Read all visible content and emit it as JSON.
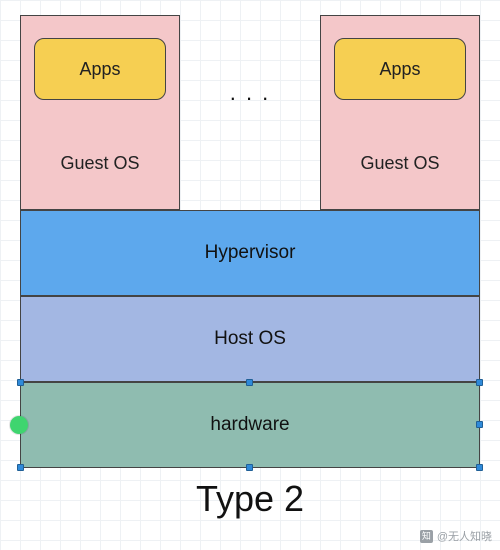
{
  "title": "Type 2",
  "ellipsis": ". . .",
  "guests": [
    {
      "app": "Apps",
      "os": "Guest OS"
    },
    {
      "app": "Apps",
      "os": "Guest OS"
    }
  ],
  "layers": {
    "hypervisor": "Hypervisor",
    "host_os": "Host OS",
    "hardware": "hardware"
  },
  "watermark": {
    "icon": "知",
    "text": "@无人知晓"
  },
  "colors": {
    "guest_bg": "#f4c7c9",
    "app_bg": "#f6cf52",
    "hypervisor_bg": "#5da8ed",
    "hostos_bg": "#a3b7e3",
    "hardware_bg": "#8fbcb0"
  }
}
